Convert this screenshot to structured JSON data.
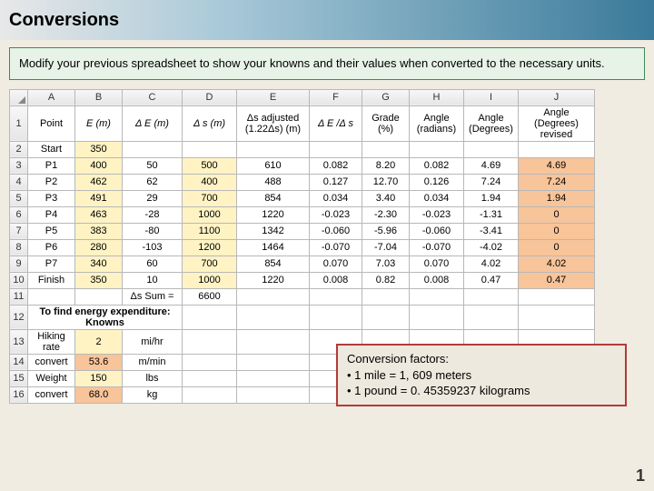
{
  "title": "Conversions",
  "instruction": "Modify your previous spreadsheet to show your knowns and their values when converted to the necessary units.",
  "cols": [
    "A",
    "B",
    "C",
    "D",
    "E",
    "F",
    "G",
    "H",
    "I",
    "J"
  ],
  "row_nums": [
    "1",
    "2",
    "3",
    "4",
    "5",
    "6",
    "7",
    "8",
    "9",
    "10",
    "11",
    "12",
    "13",
    "14",
    "15",
    "16"
  ],
  "hdr": {
    "A": "Point",
    "B": "E (m)",
    "C": "Δ E (m)",
    "D": "Δ s (m)",
    "E_l1": "Δs adjusted",
    "E_l2": "(1.22Δs) (m)",
    "F": "Δ E /Δ s",
    "G_l1": "Grade",
    "G_l2": "(%)",
    "H_l1": "Angle",
    "H_l2": "(radians)",
    "I_l1": "Angle",
    "I_l2": "(Degrees)",
    "J_l1": "Angle (Degrees)",
    "J_l2": "revised"
  },
  "rows": [
    {
      "A": "Start",
      "B": "350",
      "C": "",
      "D": "",
      "E": "",
      "F": "",
      "G": "",
      "H": "",
      "I": "",
      "J": ""
    },
    {
      "A": "P1",
      "B": "400",
      "C": "50",
      "D": "500",
      "E": "610",
      "F": "0.082",
      "G": "8.20",
      "H": "0.082",
      "I": "4.69",
      "J": "4.69"
    },
    {
      "A": "P2",
      "B": "462",
      "C": "62",
      "D": "400",
      "E": "488",
      "F": "0.127",
      "G": "12.70",
      "H": "0.126",
      "I": "7.24",
      "J": "7.24"
    },
    {
      "A": "P3",
      "B": "491",
      "C": "29",
      "D": "700",
      "E": "854",
      "F": "0.034",
      "G": "3.40",
      "H": "0.034",
      "I": "1.94",
      "J": "1.94"
    },
    {
      "A": "P4",
      "B": "463",
      "C": "-28",
      "D": "1000",
      "E": "1220",
      "F": "-0.023",
      "G": "-2.30",
      "H": "-0.023",
      "I": "-1.31",
      "J": "0"
    },
    {
      "A": "P5",
      "B": "383",
      "C": "-80",
      "D": "1100",
      "E": "1342",
      "F": "-0.060",
      "G": "-5.96",
      "H": "-0.060",
      "I": "-3.41",
      "J": "0"
    },
    {
      "A": "P6",
      "B": "280",
      "C": "-103",
      "D": "1200",
      "E": "1464",
      "F": "-0.070",
      "G": "-7.04",
      "H": "-0.070",
      "I": "-4.02",
      "J": "0"
    },
    {
      "A": "P7",
      "B": "340",
      "C": "60",
      "D": "700",
      "E": "854",
      "F": "0.070",
      "G": "7.03",
      "H": "0.070",
      "I": "4.02",
      "J": "4.02"
    },
    {
      "A": "Finish",
      "B": "350",
      "C": "10",
      "D": "1000",
      "E": "1220",
      "F": "0.008",
      "G": "0.82",
      "H": "0.008",
      "I": "0.47",
      "J": "0.47"
    }
  ],
  "sum_label": "Δs Sum =",
  "sum_value": "6600",
  "knowns_title": "To find energy expenditure: Knowns",
  "knowns": [
    {
      "label": "Hiking rate",
      "val": "2",
      "unit": "mi/hr"
    },
    {
      "label": "convert",
      "val": "53.6",
      "unit": "m/min"
    },
    {
      "label": "Weight",
      "val": "150",
      "unit": "lbs"
    },
    {
      "label": "convert",
      "val": "68.0",
      "unit": "kg"
    }
  ],
  "callout": {
    "title": "Conversion factors:",
    "l1": "• 1 mile = 1, 609 meters",
    "l2": "• 1 pound = 0. 45359237 kilograms"
  },
  "page": "1",
  "chart_data": {
    "type": "table",
    "title": "Conversions spreadsheet",
    "columns": [
      "Point",
      "E (m)",
      "ΔE (m)",
      "Δs (m)",
      "Δs adjusted (1.22Δs) (m)",
      "ΔE/Δs",
      "Grade (%)",
      "Angle (radians)",
      "Angle (Degrees)",
      "Angle (Degrees) revised"
    ],
    "data": [
      [
        "Start",
        350,
        null,
        null,
        null,
        null,
        null,
        null,
        null,
        null
      ],
      [
        "P1",
        400,
        50,
        500,
        610,
        0.082,
        8.2,
        0.082,
        4.69,
        4.69
      ],
      [
        "P2",
        462,
        62,
        400,
        488,
        0.127,
        12.7,
        0.126,
        7.24,
        7.24
      ],
      [
        "P3",
        491,
        29,
        700,
        854,
        0.034,
        3.4,
        0.034,
        1.94,
        1.94
      ],
      [
        "P4",
        463,
        -28,
        1000,
        1220,
        -0.023,
        -2.3,
        -0.023,
        -1.31,
        0
      ],
      [
        "P5",
        383,
        -80,
        1100,
        1342,
        -0.06,
        -5.96,
        -0.06,
        -3.41,
        0
      ],
      [
        "P6",
        280,
        -103,
        1200,
        1464,
        -0.07,
        -7.04,
        -0.07,
        -4.02,
        0
      ],
      [
        "P7",
        340,
        60,
        700,
        854,
        0.07,
        7.03,
        0.07,
        4.02,
        4.02
      ],
      [
        "Finish",
        350,
        10,
        1000,
        1220,
        0.008,
        0.82,
        0.008,
        0.47,
        0.47
      ]
    ],
    "sum_ds": 6600,
    "knowns": {
      "Hiking rate": "2 mi/hr",
      "convert_rate": "53.6 m/min",
      "Weight": "150 lbs",
      "convert_weight": "68.0 kg"
    }
  }
}
